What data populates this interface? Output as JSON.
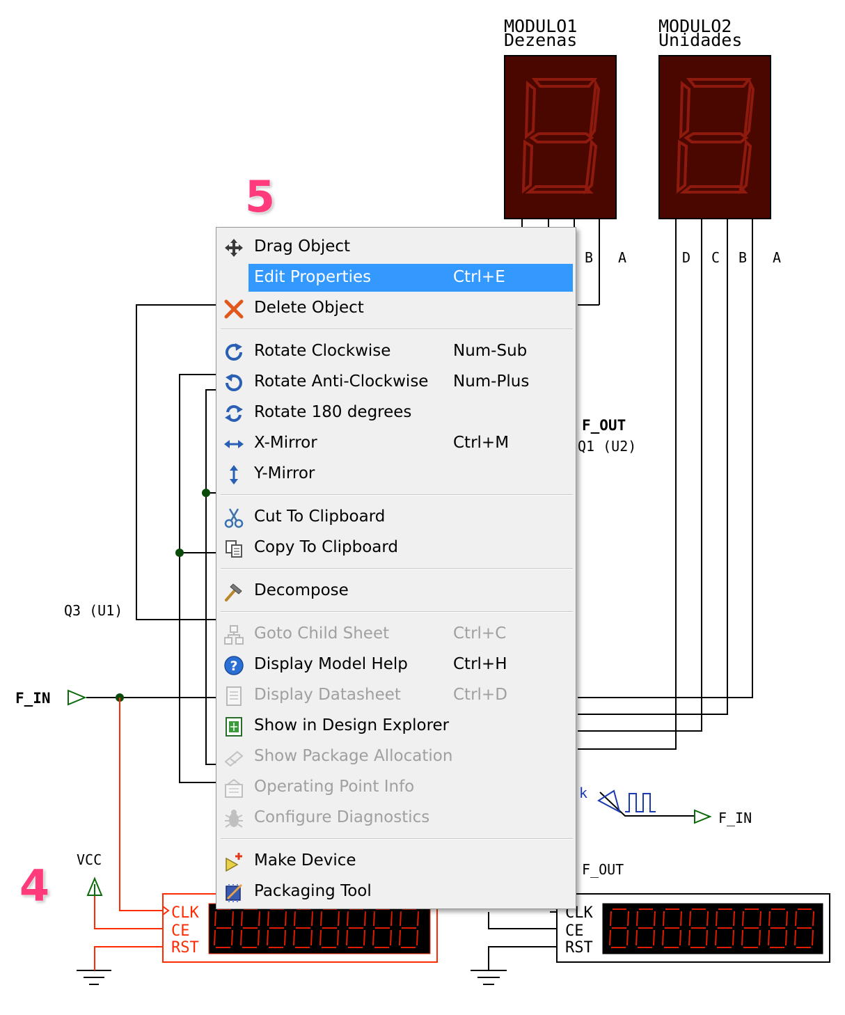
{
  "steps": {
    "step4": "4",
    "step5": "5"
  },
  "displays": {
    "modulo1": {
      "title": "MODULO1",
      "subtitle": "Dezenas",
      "pins": [
        "B",
        "A"
      ]
    },
    "modulo2": {
      "title": "MODULO2",
      "subtitle": "Unidades",
      "pins": [
        "D",
        "C",
        "B",
        "A"
      ]
    }
  },
  "schematic": {
    "q3_label": "Q3 (U1)",
    "f_out_label": "F_OUT",
    "q1_label": "Q1 (U2)",
    "f_in_left": "F_IN",
    "f_in_right": "F_IN",
    "clk_fragment": "k",
    "vcc_label": "VCC",
    "f_out_bottom": "F_OUT",
    "counter1": {
      "pins": [
        "CLK",
        "CE",
        "RST"
      ]
    },
    "counter2": {
      "pins": [
        "CLK",
        "CE",
        "RST"
      ]
    }
  },
  "context_menu": {
    "items": [
      {
        "label": "Drag Object",
        "shortcut": "",
        "icon": "move-icon",
        "enabled": true
      },
      {
        "label": "Edit Properties",
        "shortcut": "Ctrl+E",
        "icon": "none",
        "enabled": true,
        "highlighted": true
      },
      {
        "label": "Delete Object",
        "shortcut": "",
        "icon": "delete-x-icon",
        "enabled": true
      },
      {
        "label": "Rotate Clockwise",
        "shortcut": "Num-Sub",
        "icon": "rotate-cw-icon",
        "enabled": true
      },
      {
        "label": "Rotate Anti-Clockwise",
        "shortcut": "Num-Plus",
        "icon": "rotate-ccw-icon",
        "enabled": true
      },
      {
        "label": "Rotate 180 degrees",
        "shortcut": "",
        "icon": "rotate-180-icon",
        "enabled": true
      },
      {
        "label": "X-Mirror",
        "shortcut": "Ctrl+M",
        "icon": "x-mirror-icon",
        "enabled": true
      },
      {
        "label": "Y-Mirror",
        "shortcut": "",
        "icon": "y-mirror-icon",
        "enabled": true
      },
      {
        "label": "Cut To Clipboard",
        "shortcut": "",
        "icon": "scissors-icon",
        "enabled": true
      },
      {
        "label": "Copy To Clipboard",
        "shortcut": "",
        "icon": "copy-icon",
        "enabled": true
      },
      {
        "label": "Decompose",
        "shortcut": "",
        "icon": "hammer-icon",
        "enabled": true
      },
      {
        "label": "Goto Child Sheet",
        "shortcut": "Ctrl+C",
        "icon": "child-sheet-icon",
        "enabled": false
      },
      {
        "label": "Display Model Help",
        "shortcut": "Ctrl+H",
        "icon": "help-icon",
        "enabled": true
      },
      {
        "label": "Display Datasheet",
        "shortcut": "Ctrl+D",
        "icon": "datasheet-icon",
        "enabled": false
      },
      {
        "label": "Show in Design Explorer",
        "shortcut": "",
        "icon": "design-explorer-icon",
        "enabled": true
      },
      {
        "label": "Show Package Allocation",
        "shortcut": "",
        "icon": "package-allocation-icon",
        "enabled": false
      },
      {
        "label": "Operating Point Info",
        "shortcut": "",
        "icon": "operating-point-icon",
        "enabled": false
      },
      {
        "label": "Configure Diagnostics",
        "shortcut": "",
        "icon": "bug-icon",
        "enabled": false
      },
      {
        "label": "Make Device",
        "shortcut": "",
        "icon": "make-device-icon",
        "enabled": true
      },
      {
        "label": "Packaging Tool",
        "shortcut": "",
        "icon": "packaging-tool-icon",
        "enabled": true
      }
    ]
  },
  "colors": {
    "highlight": "#3399ff",
    "annotation": "#ff3b7b",
    "wire": "#000000",
    "selected": "#ff2a00",
    "segment_on": "#8e1a0e",
    "display_bg": "#4a0700"
  }
}
